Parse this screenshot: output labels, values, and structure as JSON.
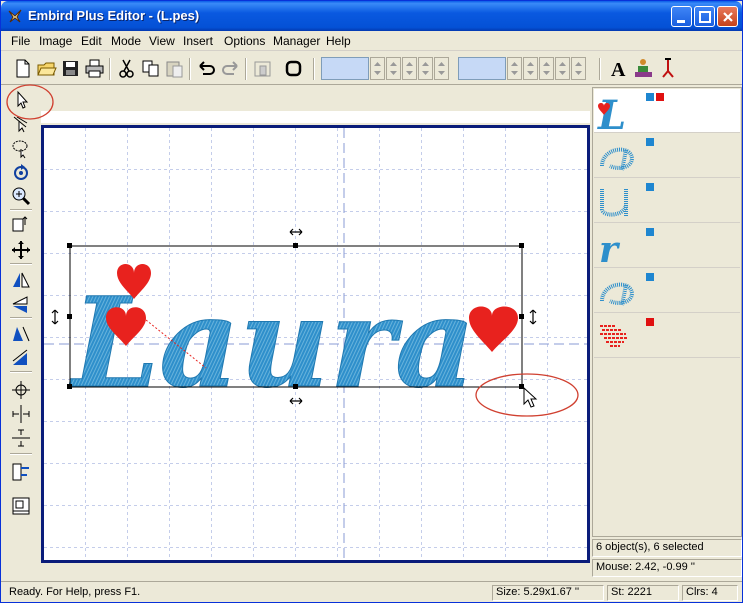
{
  "window": {
    "title": "Embird Plus Editor - (L.pes)"
  },
  "menu": {
    "items": [
      {
        "label": "File"
      },
      {
        "label": "Image"
      },
      {
        "label": "Edit"
      },
      {
        "label": "Mode"
      },
      {
        "label": "View"
      },
      {
        "label": "Insert"
      },
      {
        "label": "Options"
      },
      {
        "label": "Manager"
      },
      {
        "label": "Help"
      }
    ]
  },
  "design": {
    "text": "Laura",
    "thread_color": "#2e8fcb",
    "heart_color": "#e8221e"
  },
  "objects_panel": {
    "items": [
      {
        "icon": "L-with-heart-icon",
        "marks": [
          "#1e86d0",
          "#e01010"
        ]
      },
      {
        "icon": "stitch-a-icon",
        "marks": [
          "#1e86d0"
        ]
      },
      {
        "icon": "stitch-u-icon",
        "marks": [
          "#1e86d0"
        ]
      },
      {
        "icon": "stitch-r-icon",
        "marks": [
          "#1e86d0"
        ]
      },
      {
        "icon": "stitch-a2-icon",
        "marks": [
          "#1e86d0"
        ]
      },
      {
        "icon": "hearts-icon",
        "marks": [
          "#e01010"
        ]
      }
    ],
    "selection_info": "6 object(s), 6 selected",
    "mouse_info": "Mouse: 2.42, -0.99 ''"
  },
  "status": {
    "message": "Ready. For Help, press F1.",
    "size": "Size: 5.29x1.67 ''",
    "stitches": "St: 2221",
    "colors": "Clrs: 4"
  }
}
